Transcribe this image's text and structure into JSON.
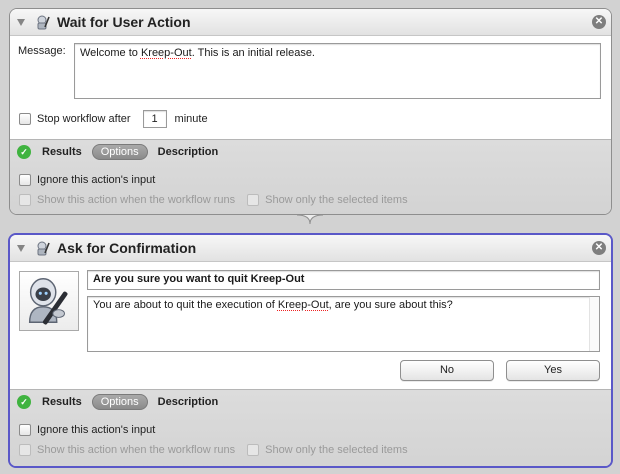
{
  "action1": {
    "title": "Wait for User Action",
    "message_label": "Message:",
    "message_parts": [
      "Welcome to ",
      "Kreep-Out",
      ". This is an initial release."
    ],
    "stop_label": "Stop workflow after",
    "stop_value": "1",
    "stop_unit": "minute",
    "tabs": {
      "results": "Results",
      "options": "Options",
      "description": "Description"
    },
    "ignore_input": "Ignore this action's input",
    "show_action": "Show this action when the workflow runs",
    "show_selected": "Show only the selected items"
  },
  "action2": {
    "title": "Ask for Confirmation",
    "question": "Are you sure you want to quit Kreep-Out",
    "body_parts": [
      "You are about to quit the execution of ",
      "Kreep-Out",
      ", are you sure about this?"
    ],
    "no_label": "No",
    "yes_label": "Yes",
    "tabs": {
      "results": "Results",
      "options": "Options",
      "description": "Description"
    },
    "ignore_input": "Ignore this action's input",
    "show_action": "Show this action when the workflow runs",
    "show_selected": "Show only the selected items"
  },
  "colors": {
    "selection_border": "#5a58c8",
    "status_green": "#3fb33f"
  },
  "icons": {
    "action_icon": "automator-robot-icon",
    "close_icon": "close-icon",
    "status_icon": "checkmark-icon",
    "app_icon": "automator-robot-icon"
  }
}
